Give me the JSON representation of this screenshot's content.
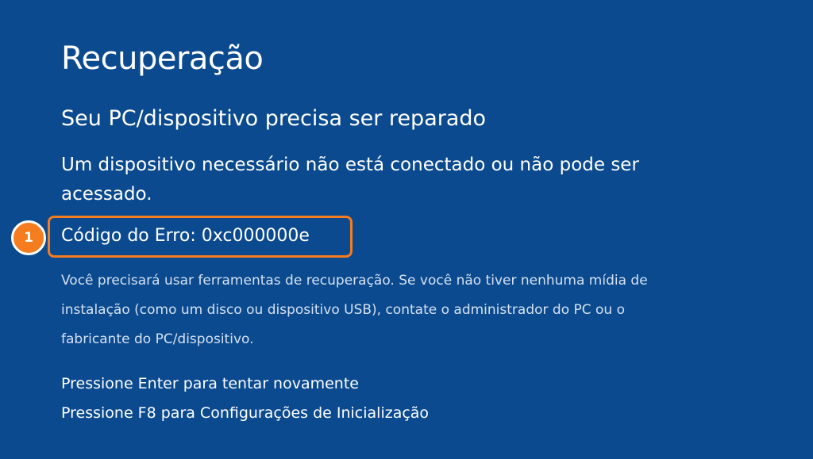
{
  "page": {
    "title": "Recuperação",
    "subtitle": "Seu PC/dispositivo precisa ser reparado",
    "message": "Um dispositivo necessário não está conectado ou não pode ser acessado.",
    "error_code": "Código do Erro: 0xc000000e",
    "callout_number": "1",
    "info": "Você precisará usar ferramentas de recuperação. Se você não tiver nenhuma mídia de instalação (como um disco ou dispositivo USB), contate o administrador do PC ou o fabricante do PC/dispositivo.",
    "actions": [
      "Pressione Enter para tentar novamente",
      "Pressione F8 para Configurações de Inicialização"
    ]
  },
  "colors": {
    "background": "#0b4a8f",
    "highlight": "#f57c1f",
    "text": "#ffffff",
    "muted_text": "#d4e1f1"
  }
}
